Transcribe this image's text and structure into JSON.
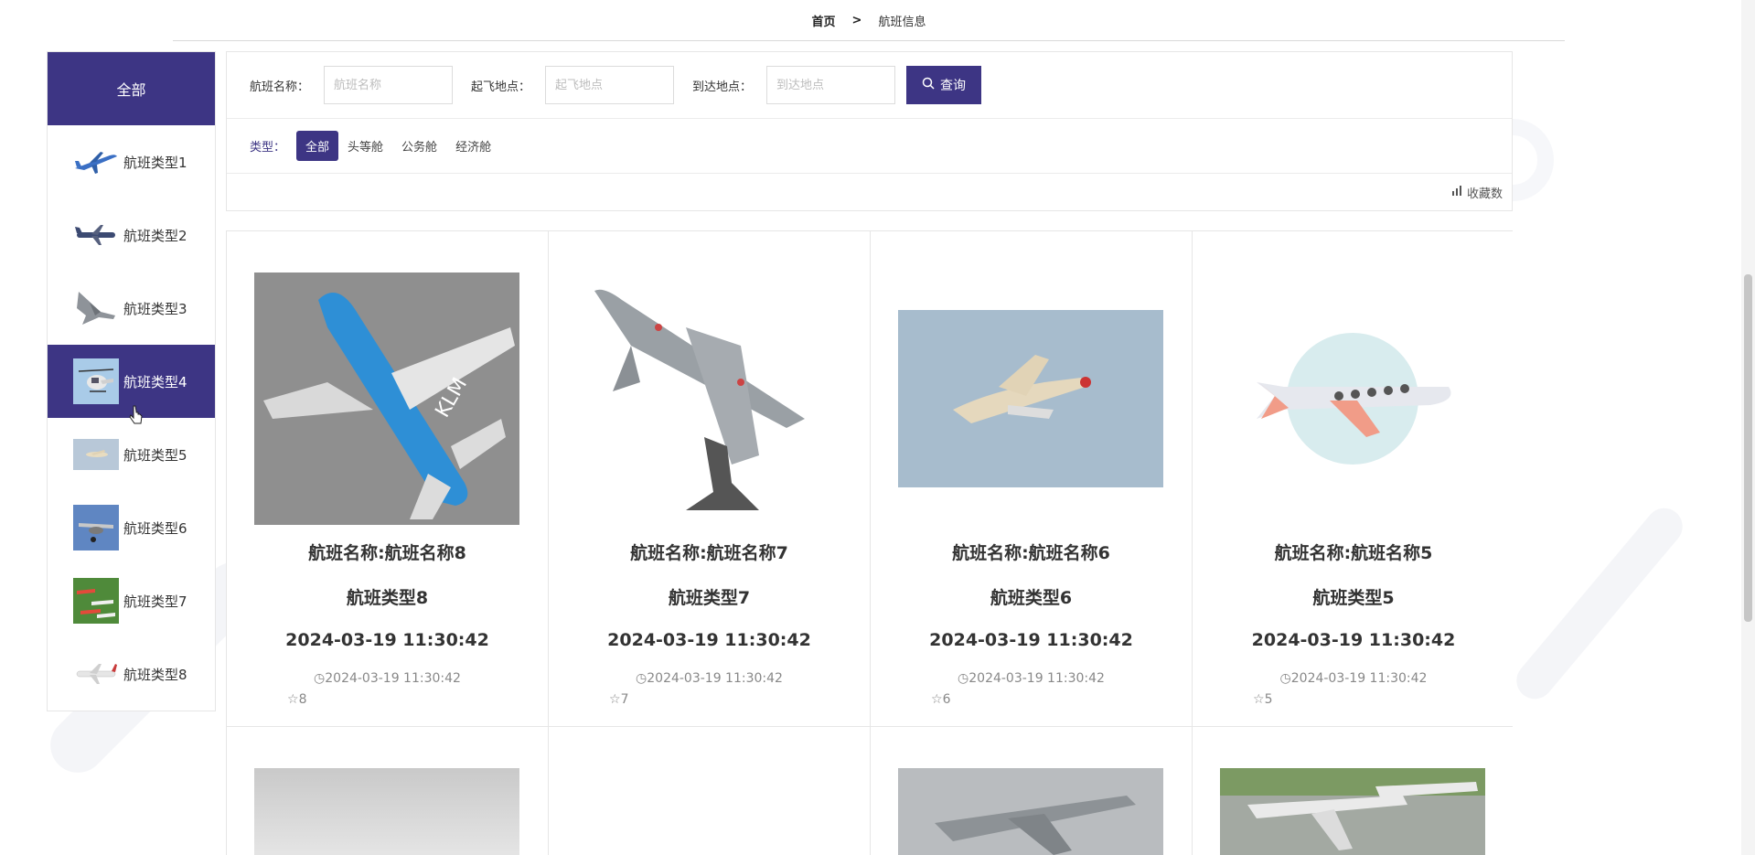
{
  "breadcrumb": {
    "home": "首页",
    "sep": ">",
    "current": "航班信息"
  },
  "sidebar": {
    "all": "全部",
    "items": [
      {
        "label": "航班类型1"
      },
      {
        "label": "航班类型2"
      },
      {
        "label": "航班类型3"
      },
      {
        "label": "航班类型4",
        "active": true
      },
      {
        "label": "航班类型5"
      },
      {
        "label": "航班类型6"
      },
      {
        "label": "航班类型7"
      },
      {
        "label": "航班类型8"
      }
    ]
  },
  "filter": {
    "name_label": "航班名称：",
    "name_placeholder": "航班名称",
    "from_label": "起飞地点：",
    "from_placeholder": "起飞地点",
    "to_label": "到达地点：",
    "to_placeholder": "到达地点",
    "query_label": "查询",
    "type_label": "类型：",
    "types": [
      "全部",
      "头等舱",
      "公务舱",
      "经济舱"
    ],
    "sort_label": "收藏数"
  },
  "cards": [
    {
      "name": "航班名称:航班名称8",
      "type": "航班类型8",
      "time": "2024-03-19 11:30:42",
      "meta_time": "2024-03-19 11:30:42",
      "favs": "8"
    },
    {
      "name": "航班名称:航班名称7",
      "type": "航班类型7",
      "time": "2024-03-19 11:30:42",
      "meta_time": "2024-03-19 11:30:42",
      "favs": "7"
    },
    {
      "name": "航班名称:航班名称6",
      "type": "航班类型6",
      "time": "2024-03-19 11:30:42",
      "meta_time": "2024-03-19 11:30:42",
      "favs": "6"
    },
    {
      "name": "航班名称:航班名称5",
      "type": "航班类型5",
      "time": "2024-03-19 11:30:42",
      "meta_time": "2024-03-19 11:30:42",
      "favs": "5"
    }
  ],
  "colors": {
    "accent": "#3d3584",
    "border": "#e6e6e6"
  }
}
